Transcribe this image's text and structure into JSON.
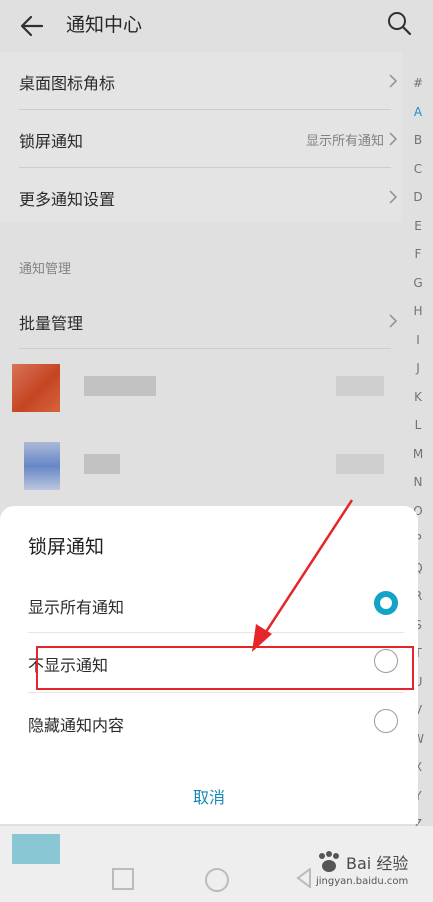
{
  "header": {
    "title": "通知中心"
  },
  "settings": {
    "row1": {
      "label": "桌面图标角标"
    },
    "row2": {
      "label": "锁屏通知",
      "value": "显示所有通知"
    },
    "row3": {
      "label": "更多通知设置"
    }
  },
  "section": {
    "title": "通知管理"
  },
  "batch": {
    "label": "批量管理"
  },
  "index_letters": [
    "#",
    "A",
    "B",
    "C",
    "D",
    "E",
    "F",
    "G",
    "H",
    "I",
    "J",
    "K",
    "L",
    "M",
    "N",
    "O",
    "P",
    "Q",
    "R",
    "S",
    "T",
    "U",
    "V",
    "W",
    "X",
    "Y",
    "Z"
  ],
  "dialog": {
    "title": "锁屏通知",
    "options": [
      {
        "label": "显示所有通知",
        "selected": true
      },
      {
        "label": "不显示通知",
        "selected": false
      },
      {
        "label": "隐藏通知内容",
        "selected": false
      }
    ],
    "cancel": "取消"
  },
  "colors": {
    "accent": "#12a3c6",
    "annotation": "#e5252a"
  },
  "watermark": {
    "text": "Bai 经验",
    "url": "jingyan.baidu.com"
  }
}
